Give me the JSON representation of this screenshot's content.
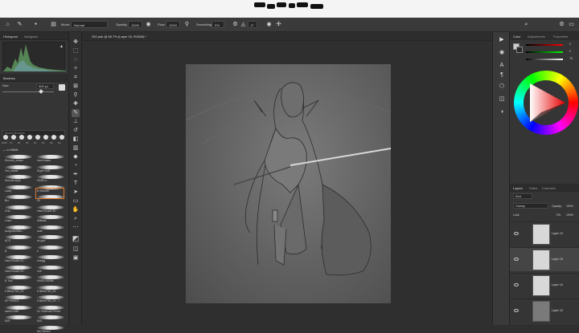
{
  "options_bar": {
    "mode_label": "Mode:",
    "mode_value": "Normal",
    "opacity_label": "Opacity:",
    "opacity_value": "100%",
    "flow_label": "Flow:",
    "flow_value": "100%",
    "smoothing_label": "Smoothing:",
    "smoothing_value": "0%",
    "angle_value": "0°",
    "share_label": "Share"
  },
  "left_panel": {
    "tabs": [
      "Histogram",
      "Navigator"
    ],
    "brushes_title": "Brushes",
    "size_label": "Size",
    "size_value": "900 px",
    "search_placeholder": "Search Brushes",
    "preset_sizes": [
      "2000",
      "70",
      "85",
      "35",
      "40",
      "30",
      "36",
      "60"
    ],
    "folder_name": "MAIN",
    "brush_names_left": [
      "Smooth_eraser",
      "Tex_eraser",
      "Smooth style",
      "Lasty",
      "Bro",
      "Grid",
      "Lines",
      "Aufgeräumtes...",
      "ACE",
      "B",
      "Hard Round 20...",
      "Hard Round 20...",
      "B Tool",
      "5 Blend Tex_03",
      "DP PENCIL",
      "sketch bold",
      "K05"
    ],
    "brush_names_right": [
      "hard eraser",
      "Super Soft",
      "HARD s",
      "B Smooth",
      "09",
      "Hard Round 30...",
      "Mittwas",
      "ucat",
      "nk god",
      "b",
      "smugg",
      "one",
      "HARD DRAW",
      "5 Blend Tex_04",
      "5 Blend Tex_13 - T",
      "DJ Charcoal Pencil",
      "K05",
      "MK-Sketch"
    ]
  },
  "document": {
    "tab_label": "252.psb @ 66.7% (Layer 15, RGB/8) *"
  },
  "color_panel": {
    "tabs": [
      "Color",
      "Adjustments",
      "Properties"
    ],
    "slider_values": [
      "0",
      "0",
      "76"
    ],
    "accent_colors": {
      "share": "#2d7bf5",
      "selected_brush": "#e07a2d"
    }
  },
  "layers_panel": {
    "tabs": [
      "Layers",
      "Paths",
      "Channels"
    ],
    "kind_label": "Kind",
    "blend_mode": "Overlay",
    "opacity_label": "Opacity:",
    "opacity_value": "100%",
    "lock_label": "Lock:",
    "fill_label": "Fill:",
    "fill_value": "100%",
    "layers": [
      "Layer 13",
      "Layer 15",
      "Layer 14",
      "Layer 10"
    ]
  }
}
